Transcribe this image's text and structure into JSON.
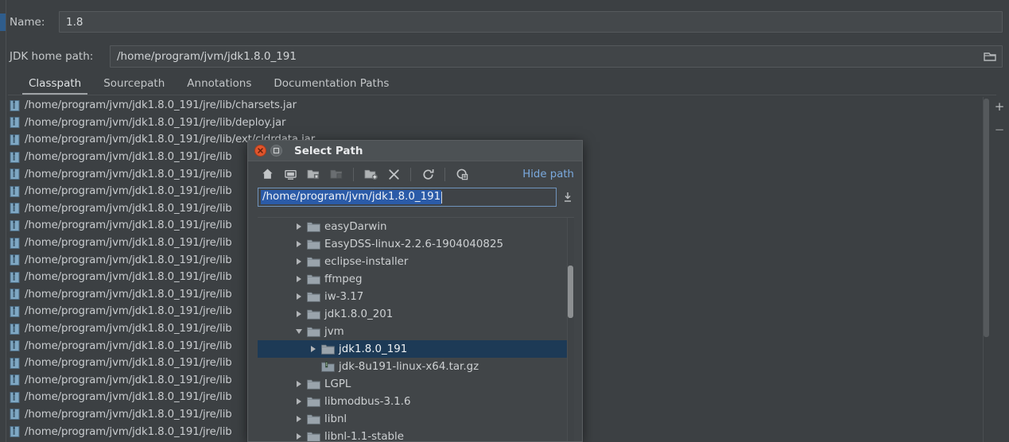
{
  "colors": {
    "app_bg": "#3c4043",
    "field_bg": "#44484b",
    "dialog_bg": "#414548",
    "titlebar_bg": "#4c5154",
    "accent_blue": "#2f5d8c",
    "selection_blue": "#2b5ba8",
    "tree_selection": "#1d3a56",
    "link_blue": "#7aa9dd",
    "close_red": "#e0552c",
    "text": "#c8cbcd"
  },
  "form": {
    "name_label": "Name:",
    "name_value": "1.8",
    "jdk_home_label": "JDK home path:",
    "jdk_home_value": "/home/program/jvm/jdk1.8.0_191",
    "browse_icon": "folder-browse-icon"
  },
  "tabs": [
    {
      "label": "Classpath",
      "active": true
    },
    {
      "label": "Sourcepath",
      "active": false
    },
    {
      "label": "Annotations",
      "active": false
    },
    {
      "label": "Documentation Paths",
      "active": false
    }
  ],
  "classpath": {
    "icon": "jar-file-icon",
    "add_button": "+",
    "remove_button": "−",
    "entries": [
      "/home/program/jvm/jdk1.8.0_191/jre/lib/charsets.jar",
      "/home/program/jvm/jdk1.8.0_191/jre/lib/deploy.jar",
      "/home/program/jvm/jdk1.8.0_191/jre/lib/ext/cldrdata.jar",
      "/home/program/jvm/jdk1.8.0_191/jre/lib",
      "/home/program/jvm/jdk1.8.0_191/jre/lib",
      "/home/program/jvm/jdk1.8.0_191/jre/lib",
      "/home/program/jvm/jdk1.8.0_191/jre/lib",
      "/home/program/jvm/jdk1.8.0_191/jre/lib",
      "/home/program/jvm/jdk1.8.0_191/jre/lib",
      "/home/program/jvm/jdk1.8.0_191/jre/lib",
      "/home/program/jvm/jdk1.8.0_191/jre/lib",
      "/home/program/jvm/jdk1.8.0_191/jre/lib",
      "/home/program/jvm/jdk1.8.0_191/jre/lib",
      "/home/program/jvm/jdk1.8.0_191/jre/lib",
      "/home/program/jvm/jdk1.8.0_191/jre/lib",
      "/home/program/jvm/jdk1.8.0_191/jre/lib",
      "/home/program/jvm/jdk1.8.0_191/jre/lib",
      "/home/program/jvm/jdk1.8.0_191/jre/lib",
      "/home/program/jvm/jdk1.8.0_191/jre/lib",
      "/home/program/jvm/jdk1.8.0_191/jre/lib"
    ]
  },
  "dialog": {
    "title": "Select Path",
    "close_button": "close-window-button",
    "minimize_button": "minimize-window-button",
    "toolbar": [
      {
        "name": "home-icon",
        "disabled": false
      },
      {
        "name": "desktop-icon",
        "disabled": false
      },
      {
        "name": "folder-up-icon",
        "disabled": false
      },
      {
        "name": "folder-icon",
        "disabled": true
      },
      {
        "name": "new-folder-icon",
        "disabled": false
      },
      {
        "name": "delete-icon",
        "disabled": false
      },
      {
        "name": "refresh-icon",
        "disabled": false
      },
      {
        "name": "show-hidden-icon",
        "disabled": false
      }
    ],
    "hide_path_label": "Hide path",
    "path_value": "/home/program/jvm/jdk1.8.0_191",
    "path_placeholder": "",
    "drop_icon": "download-path-icon",
    "tree": [
      {
        "label": "easyDarwin",
        "indent": 1,
        "state": "closed",
        "icon": "folder-icon",
        "selected": false
      },
      {
        "label": "EasyDSS-linux-2.2.6-1904040825",
        "indent": 1,
        "state": "closed",
        "icon": "folder-icon",
        "selected": false
      },
      {
        "label": "eclipse-installer",
        "indent": 1,
        "state": "closed",
        "icon": "folder-icon",
        "selected": false
      },
      {
        "label": "ffmpeg",
        "indent": 1,
        "state": "closed",
        "icon": "folder-icon",
        "selected": false
      },
      {
        "label": "iw-3.17",
        "indent": 1,
        "state": "closed",
        "icon": "folder-icon",
        "selected": false
      },
      {
        "label": "jdk1.8.0_201",
        "indent": 1,
        "state": "closed",
        "icon": "folder-icon",
        "selected": false
      },
      {
        "label": "jvm",
        "indent": 1,
        "state": "open",
        "icon": "folder-icon",
        "selected": false
      },
      {
        "label": "jdk1.8.0_191",
        "indent": 2,
        "state": "closed",
        "icon": "folder-icon",
        "selected": true
      },
      {
        "label": "jdk-8u191-linux-x64.tar.gz",
        "indent": 2,
        "state": "leaf",
        "icon": "archive-icon",
        "selected": false
      },
      {
        "label": "LGPL",
        "indent": 1,
        "state": "closed",
        "icon": "folder-icon",
        "selected": false
      },
      {
        "label": "libmodbus-3.1.6",
        "indent": 1,
        "state": "closed",
        "icon": "folder-icon",
        "selected": false
      },
      {
        "label": "libnl",
        "indent": 1,
        "state": "closed",
        "icon": "folder-icon",
        "selected": false
      },
      {
        "label": "libnl-1.1-stable",
        "indent": 1,
        "state": "closed",
        "icon": "folder-icon",
        "selected": false
      }
    ]
  }
}
